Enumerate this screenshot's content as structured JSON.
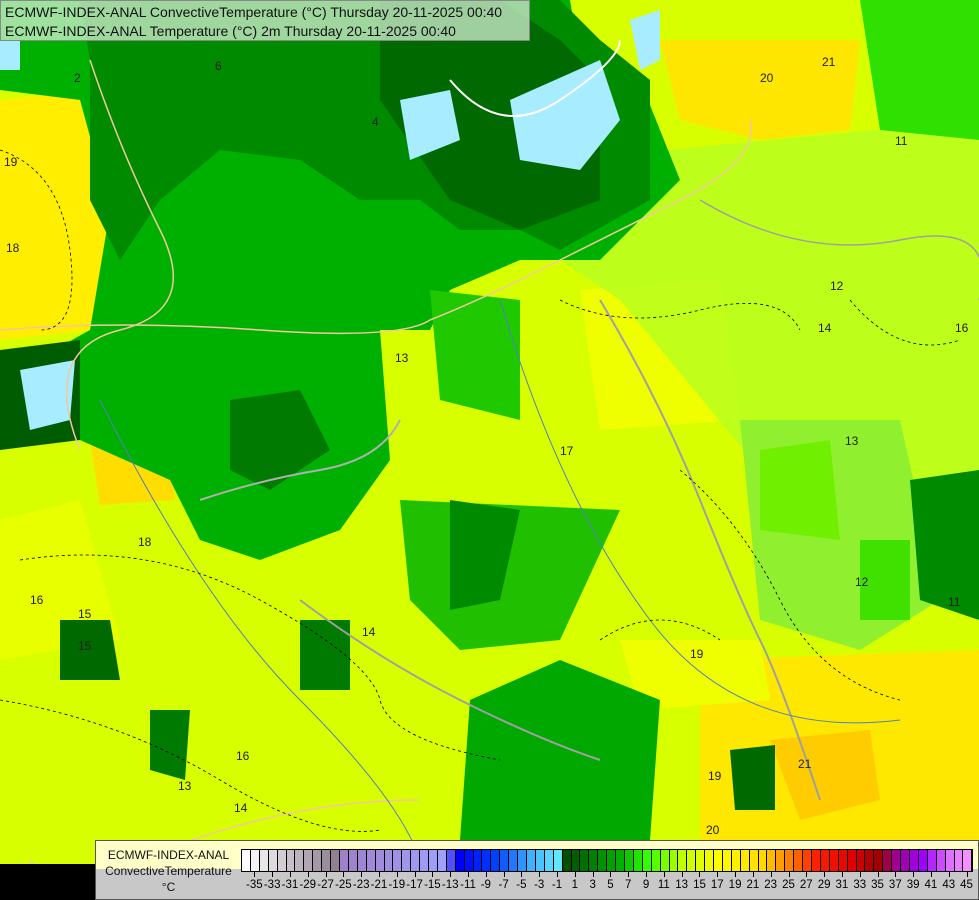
{
  "title": {
    "line1": "ECMWF-INDEX-ANAL ConvectiveTemperature (°C) Thursday 20-11-2025 00:40",
    "line2": "ECMWF-INDEX-ANAL Temperature (°C) 2m Thursday 20-11-2025 00:40"
  },
  "legend": {
    "model": "ECMWF-INDEX-ANAL",
    "parameter": "ConvectiveTemperature",
    "unit": "°C",
    "tick_labels": [
      "-35",
      "-33",
      "-31",
      "-29",
      "-27",
      "-25",
      "-23",
      "-21",
      "-19",
      "-17",
      "-15",
      "-13",
      "-11",
      "-9",
      "-7",
      "-5",
      "-3",
      "-1",
      "1",
      "3",
      "5",
      "7",
      "9",
      "11",
      "13",
      "15",
      "17",
      "19",
      "21",
      "23",
      "25",
      "27",
      "29",
      "31",
      "33",
      "35",
      "37",
      "39",
      "41",
      "43",
      "45"
    ],
    "range": [
      -36,
      46
    ],
    "color_stops": [
      [
        -36,
        "#ffffff"
      ],
      [
        -26,
        "#908090"
      ],
      [
        -25,
        "#a080c8"
      ],
      [
        -14,
        "#a0a0ff"
      ],
      [
        -12,
        "#0000ff"
      ],
      [
        -8,
        "#0040ff"
      ],
      [
        -4,
        "#40b0ff"
      ],
      [
        -1,
        "#60e8ff"
      ],
      [
        0,
        "#005000"
      ],
      [
        6,
        "#00b000"
      ],
      [
        9,
        "#30ff00"
      ],
      [
        13,
        "#c0ff00"
      ],
      [
        17,
        "#ffff00"
      ],
      [
        22,
        "#ffd800"
      ],
      [
        25,
        "#ff8000"
      ],
      [
        28,
        "#ff2000"
      ],
      [
        32,
        "#e00000"
      ],
      [
        35,
        "#a00000"
      ],
      [
        37,
        "#a00090"
      ],
      [
        40,
        "#a000ff"
      ],
      [
        43,
        "#e070ff"
      ],
      [
        46,
        "#ffa0ff"
      ]
    ]
  },
  "map": {
    "contour_labels": [
      "19",
      "18",
      "16",
      "15",
      "14",
      "13",
      "12",
      "11",
      "6",
      "4",
      "2",
      "17",
      "20",
      "21",
      "16",
      "14",
      "13",
      "12",
      "11",
      "19",
      "18",
      "15",
      "16",
      "14",
      "13",
      "19",
      "20",
      "21"
    ]
  }
}
